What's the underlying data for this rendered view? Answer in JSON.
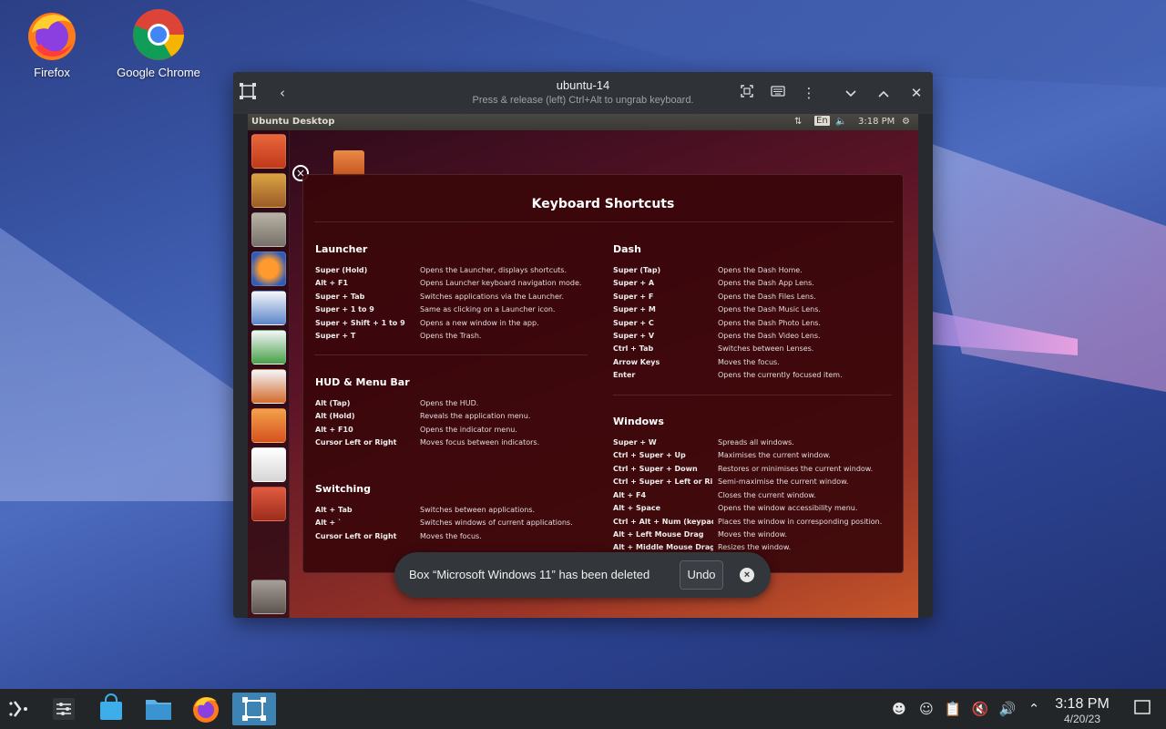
{
  "desktop": {
    "icons": [
      {
        "label": "Firefox",
        "icon": "firefox-icon"
      },
      {
        "label": "Google Chrome",
        "icon": "chrome-icon"
      }
    ]
  },
  "window": {
    "title": "ubuntu-14",
    "subtitle": "Press & release (left) Ctrl+Alt to ungrab keyboard."
  },
  "vm": {
    "panel_title": "Ubuntu Desktop",
    "panel_lang": "En",
    "panel_time": "3:18 PM",
    "overlay_title": "Keyboard Shortcuts",
    "sections": {
      "launcher": {
        "title": "Launcher",
        "rows": [
          {
            "key": "Super (Hold)",
            "desc": "Opens the Launcher, displays shortcuts."
          },
          {
            "key": "Alt + F1",
            "desc": "Opens Launcher keyboard navigation mode."
          },
          {
            "key": "Super + Tab",
            "desc": "Switches applications via the Launcher."
          },
          {
            "key": "Super + 1 to 9",
            "desc": "Same as clicking on a Launcher icon."
          },
          {
            "key": "Super + Shift + 1 to 9",
            "desc": "Opens a new window in the app."
          },
          {
            "key": "Super + T",
            "desc": "Opens the Trash."
          }
        ]
      },
      "hud": {
        "title": "HUD & Menu Bar",
        "rows": [
          {
            "key": "Alt (Tap)",
            "desc": "Opens the HUD."
          },
          {
            "key": "Alt (Hold)",
            "desc": "Reveals the application menu."
          },
          {
            "key": "Alt + F10",
            "desc": "Opens the indicator menu."
          },
          {
            "key": "Cursor Left or Right",
            "desc": "Moves focus between indicators."
          }
        ]
      },
      "switching": {
        "title": "Switching",
        "rows": [
          {
            "key": "Alt + Tab",
            "desc": "Switches between applications."
          },
          {
            "key": "Alt + `",
            "desc": "Switches windows of current applications."
          },
          {
            "key": "Cursor Left or Right",
            "desc": "Moves the focus."
          }
        ]
      },
      "dash": {
        "title": "Dash",
        "rows": [
          {
            "key": "Super (Tap)",
            "desc": "Opens the Dash Home."
          },
          {
            "key": "Super + A",
            "desc": "Opens the Dash App Lens."
          },
          {
            "key": "Super + F",
            "desc": "Opens the Dash Files Lens."
          },
          {
            "key": "Super + M",
            "desc": "Opens the Dash Music Lens."
          },
          {
            "key": "Super + C",
            "desc": "Opens the Dash Photo Lens."
          },
          {
            "key": "Super + V",
            "desc": "Opens the Dash Video Lens."
          },
          {
            "key": "Ctrl + Tab",
            "desc": "Switches between Lenses."
          },
          {
            "key": "Arrow Keys",
            "desc": "Moves the focus."
          },
          {
            "key": "Enter",
            "desc": "Opens the currently focused item."
          }
        ]
      },
      "windows": {
        "title": "Windows",
        "rows": [
          {
            "key": "Super + W",
            "desc": "Spreads all windows."
          },
          {
            "key": "Ctrl + Super + Up",
            "desc": "Maximises the current window."
          },
          {
            "key": "Ctrl + Super + Down",
            "desc": "Restores or minimises the current window."
          },
          {
            "key": "Ctrl + Super + Left or Ri...",
            "desc": "Semi-maximise the current window."
          },
          {
            "key": "Alt + F4",
            "desc": "Closes the current window."
          },
          {
            "key": "Alt + Space",
            "desc": "Opens the window accessibility menu."
          },
          {
            "key": "Ctrl + Alt + Num (keypad)",
            "desc": "Places the window in corresponding position."
          },
          {
            "key": "Alt + Left Mouse Drag",
            "desc": "Moves the window."
          },
          {
            "key": "Alt + Middle Mouse Drag",
            "desc": "Resizes the window."
          }
        ]
      }
    }
  },
  "toast": {
    "message": "Box “Microsoft Windows 11” has been deleted",
    "undo_label": "Undo"
  },
  "taskbar": {
    "time": "3:18 PM",
    "date": "4/20/23"
  },
  "colors": {
    "taskbar_bg": "#232629",
    "active_task": "#3d84b5",
    "window_bg": "#2f3236",
    "toast_bg": "#33363b"
  }
}
